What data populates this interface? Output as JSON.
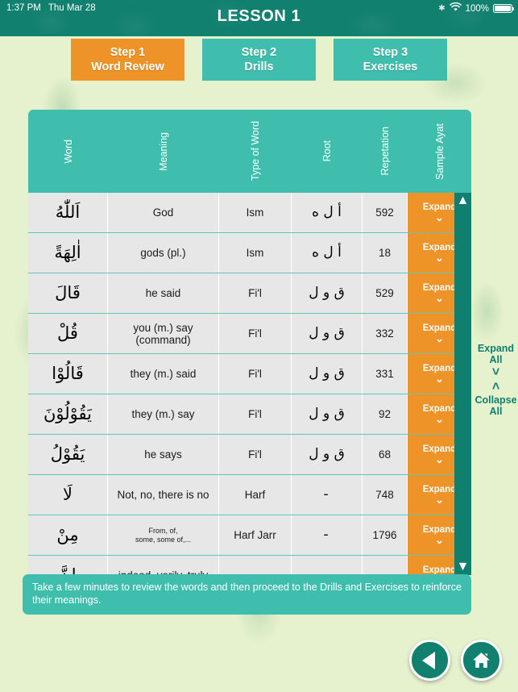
{
  "status_bar": {
    "time": "1:37 PM",
    "date": "Thu Mar 28",
    "bluetooth_icon": "bluetooth-icon",
    "wifi_icon": "wifi-icon",
    "battery_percent": "100%"
  },
  "header": {
    "title": "LESSON 1",
    "bar_color": "#11806f"
  },
  "tabs": [
    {
      "line1": "Step 1",
      "line2": "Word Review",
      "active": true,
      "color": "#ee9328"
    },
    {
      "line1": "Step 2",
      "line2": "Drills",
      "active": false,
      "color": "#3fbead"
    },
    {
      "line1": "Step 3",
      "line2": "Exercises",
      "active": false,
      "color": "#3fbead"
    }
  ],
  "table": {
    "accent_color": "#3fbead",
    "expand_color": "#ee9328",
    "columns": [
      "Word",
      "Meaning",
      "Type of Word",
      "Root",
      "Repetation",
      "Sample Ayat"
    ],
    "expand_label": "Expand",
    "expand_chevron": "chevron-down-icon",
    "rows": [
      {
        "word": "اَللّٰهُ",
        "meaning": "God",
        "type": "Ism",
        "root": "أ ل ه",
        "repetition": "592",
        "action": "Expand"
      },
      {
        "word": "اٰلِهَةً",
        "meaning": "gods (pl.)",
        "type": "Ism",
        "root": "أ ل ه",
        "repetition": "18",
        "action": "Expand"
      },
      {
        "word": "قَالَ",
        "meaning": "he said",
        "type": "Fi'l",
        "root": "ق و ل",
        "repetition": "529",
        "action": "Expand"
      },
      {
        "word": "قُلْ",
        "meaning": "you (m.) say\n(command)",
        "type": "Fi'l",
        "root": "ق و ل",
        "repetition": "332",
        "action": "Expand"
      },
      {
        "word": "قَالُوْا",
        "meaning": "they (m.) said",
        "type": "Fi'l",
        "root": "ق و ل",
        "repetition": "331",
        "action": "Expand"
      },
      {
        "word": "يَقُوْلُوْنَ",
        "meaning": "they (m.) say",
        "type": "Fi'l",
        "root": "ق و ل",
        "repetition": "92",
        "action": "Expand"
      },
      {
        "word": "يَقُوْلُ",
        "meaning": "he says",
        "type": "Fi'l",
        "root": "ق و ل",
        "repetition": "68",
        "action": "Expand"
      },
      {
        "word": "لَا",
        "meaning": "Not, no, there is no",
        "type": "Harf",
        "root": "-",
        "repetition": "748",
        "action": "Expand"
      },
      {
        "word": "مِنْ",
        "meaning": "From, of,\nsome, some of,...",
        "type": "Harf Jarr",
        "root": "-",
        "repetition": "1796",
        "action": "Expand",
        "small_meaning": true
      },
      {
        "word": "اِنَّ",
        "meaning": "indeed, verily, truly",
        "type": "",
        "root": "",
        "repetition": "",
        "action": "Expand"
      }
    ]
  },
  "scrollbar": {
    "up_icon": "chevron-up-icon",
    "down_icon": "chevron-down-icon",
    "track_color": "#0f7f6f"
  },
  "side_controls": {
    "expand_all": "Expand\nAll",
    "expand_all_line1": "Expand",
    "expand_all_line2": "All",
    "expand_icon": "chevron-down-icon",
    "collapse_icon": "chevron-up-icon",
    "collapse_all_line1": "Collapse",
    "collapse_all_line2": "All",
    "text_color": "#0f7f6f"
  },
  "hint": {
    "text": "Take a few minutes to review the words and then proceed to the Drills and Exercises to reinforce their meanings."
  },
  "nav": {
    "back_icon": "back-triangle-icon",
    "home_icon": "home-icon"
  }
}
